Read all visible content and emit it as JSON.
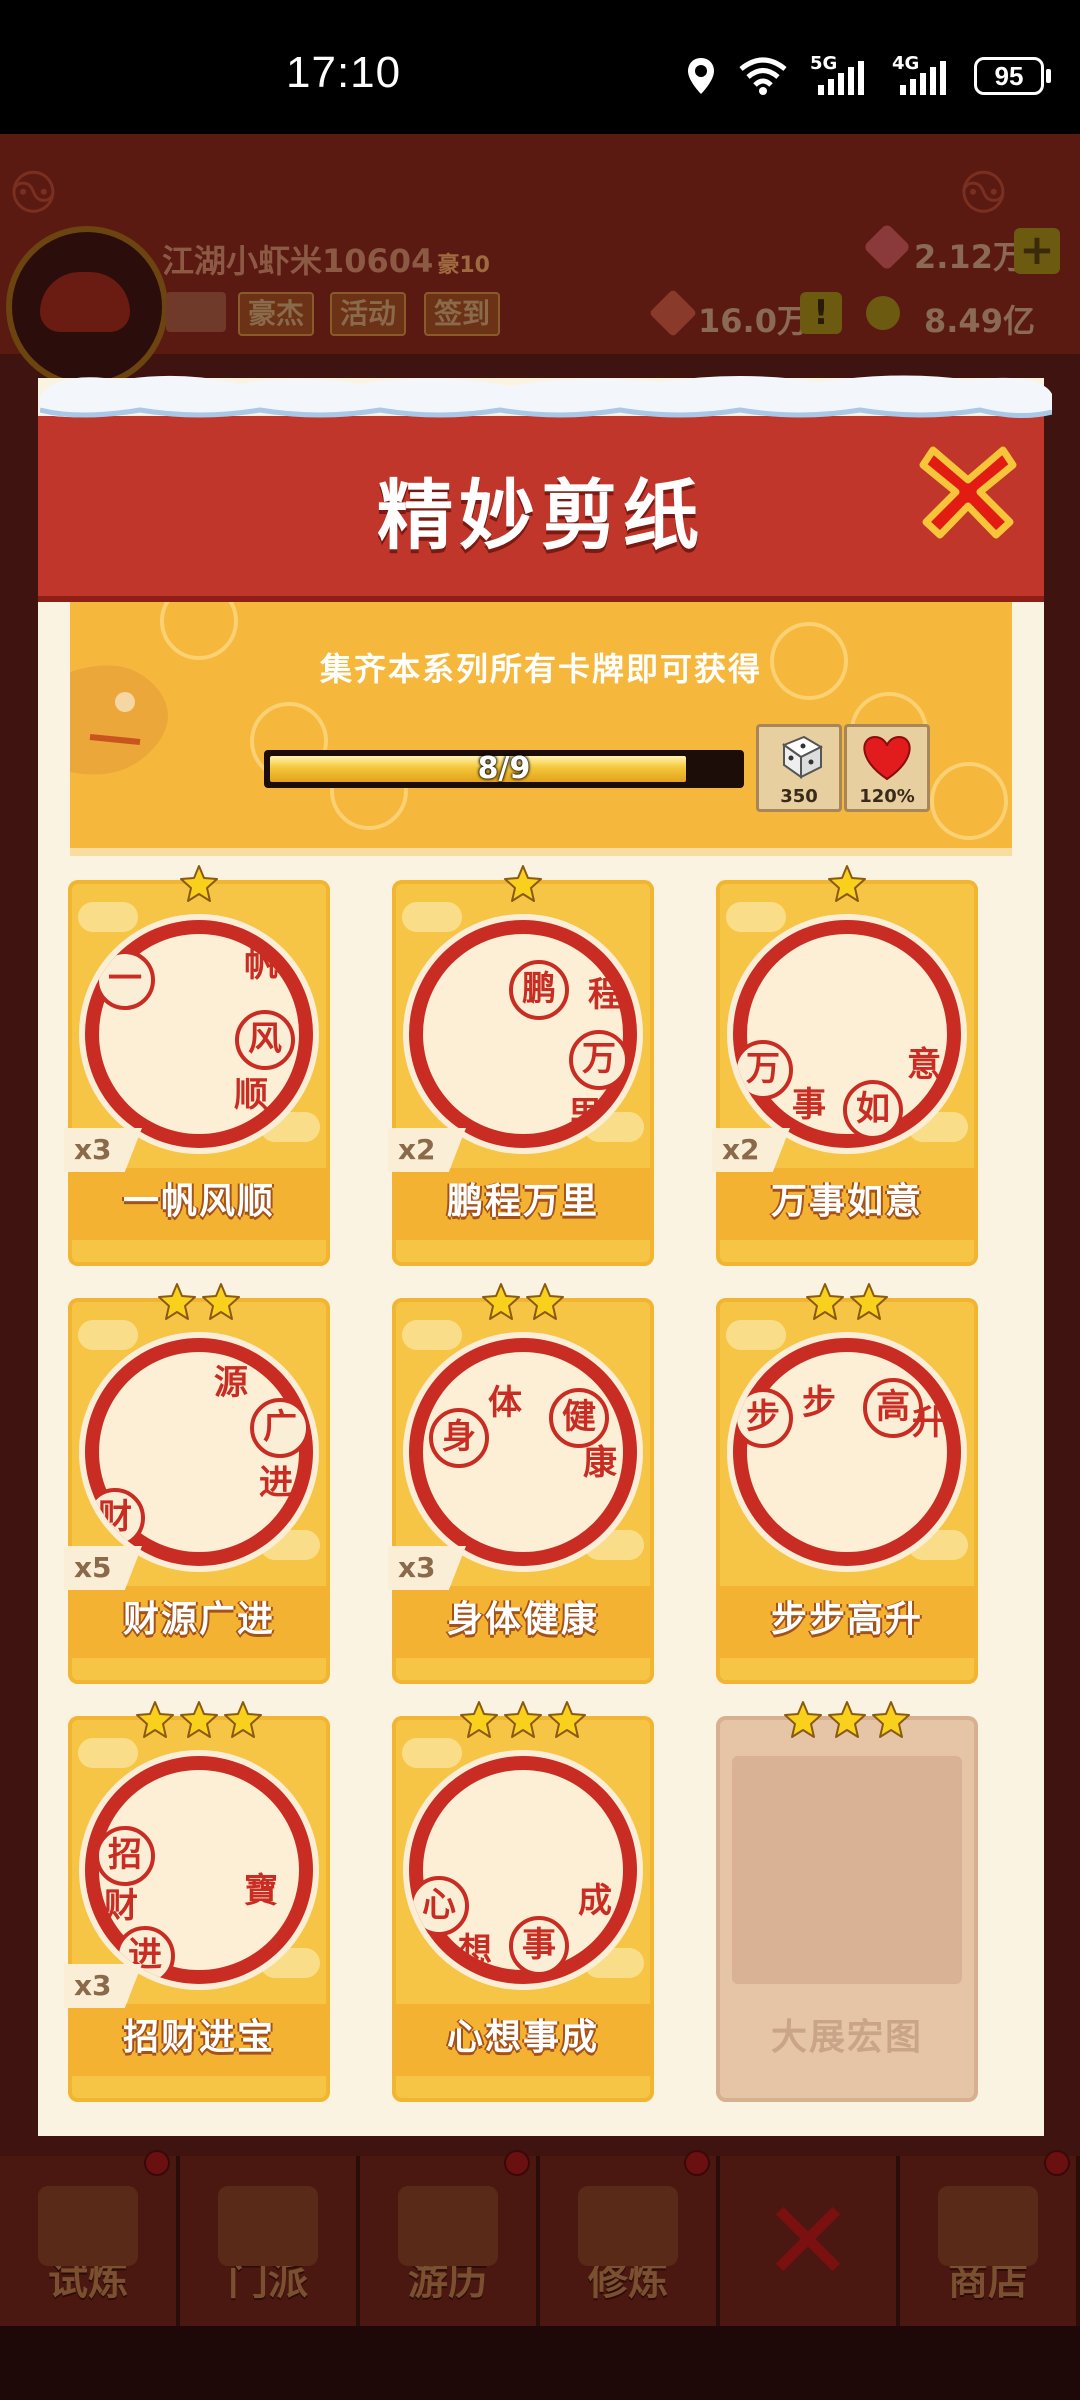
{
  "status_bar": {
    "time": "17:10",
    "net1": "5G",
    "net2": "4G",
    "battery": "95"
  },
  "game": {
    "player_name": "江湖小虾米10604",
    "vip": "豪10",
    "buttons": [
      "豪杰",
      "活动",
      "签到"
    ],
    "gems": "2.12万",
    "power": "16.0万",
    "coins": "8.49亿"
  },
  "nav": [
    "试炼",
    "门派",
    "游历",
    "修炼",
    "",
    "商店"
  ],
  "modal": {
    "title": "精妙剪纸",
    "banner_text": "集齐本系列所有卡牌即可获得",
    "progress": {
      "current": 8,
      "total": 9,
      "label": "8/9"
    },
    "rewards": [
      {
        "icon": "dice-icon",
        "value": "350"
      },
      {
        "icon": "heart-icon",
        "value": "120%"
      }
    ]
  },
  "cards": [
    {
      "name": "一帆风顺",
      "count": "x3",
      "stars": 1,
      "chars": [
        "一",
        "帆",
        "风",
        "顺"
      ]
    },
    {
      "name": "鹏程万里",
      "count": "x2",
      "stars": 1,
      "chars": [
        "鹏",
        "程",
        "万",
        "里"
      ]
    },
    {
      "name": "万事如意",
      "count": "x2",
      "stars": 1,
      "chars": [
        "万",
        "事",
        "如",
        "意"
      ]
    },
    {
      "name": "财源广进",
      "count": "x5",
      "stars": 2,
      "chars": [
        "财",
        "源",
        "广",
        "进"
      ]
    },
    {
      "name": "身体健康",
      "count": "x3",
      "stars": 2,
      "chars": [
        "身",
        "体",
        "健",
        "康"
      ]
    },
    {
      "name": "步步高升",
      "count": "",
      "stars": 2,
      "chars": [
        "步",
        "步",
        "高",
        "升"
      ]
    },
    {
      "name": "招财进宝",
      "count": "x3",
      "stars": 3,
      "chars": [
        "招",
        "财",
        "进",
        "寶"
      ]
    },
    {
      "name": "心想事成",
      "count": "",
      "stars": 3,
      "chars": [
        "心",
        "想",
        "事",
        "成"
      ]
    },
    {
      "name": "大展宏图",
      "count": "",
      "stars": 3,
      "locked": true,
      "chars": []
    }
  ]
}
